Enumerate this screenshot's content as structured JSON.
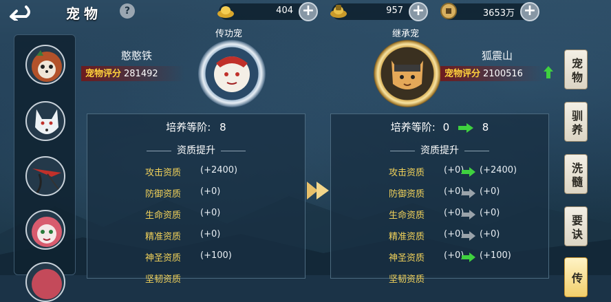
{
  "header": {
    "title": "宠物",
    "help_label": "?"
  },
  "resources": [
    {
      "icon": "gold-ingot-icon",
      "value": "404"
    },
    {
      "icon": "bound-ingot-icon",
      "value": "957"
    },
    {
      "icon": "copper-coin-icon",
      "value": "3653万"
    }
  ],
  "pets": [
    {
      "name": "red-panda-avatar"
    },
    {
      "name": "white-wolf-avatar"
    },
    {
      "name": "crane-avatar"
    },
    {
      "name": "lion-dance-cat-avatar"
    },
    {
      "name": "pet-avatar-5"
    }
  ],
  "left": {
    "role": "传功宠",
    "name": "憨憨铁",
    "score_label": "宠物评分",
    "score": "281492",
    "level_label": "培养等阶:",
    "level": "8",
    "section": "资质提升",
    "rows": [
      {
        "k": "攻击资质",
        "v": "(+2400)"
      },
      {
        "k": "防御资质",
        "v": "(+0)"
      },
      {
        "k": "生命资质",
        "v": "(+0)"
      },
      {
        "k": "精准资质",
        "v": "(+0)"
      },
      {
        "k": "神圣资质",
        "v": "(+100)"
      },
      {
        "k": "坚韧资质",
        "v": ""
      }
    ]
  },
  "right": {
    "role": "继承宠",
    "name": "狐震山",
    "score_label": "宠物评分",
    "score": "2100516",
    "level_label": "培养等阶:",
    "level_from": "0",
    "level_to": "8",
    "section": "资质提升",
    "rows": [
      {
        "k": "攻击资质",
        "v": "(+0)",
        "r": "(+2400)",
        "up": true
      },
      {
        "k": "防御资质",
        "v": "(+0)",
        "r": "(+0)",
        "up": false
      },
      {
        "k": "生命资质",
        "v": "(+0)",
        "r": "(+0)",
        "up": false
      },
      {
        "k": "精准资质",
        "v": "(+0)",
        "r": "(+0)",
        "up": false
      },
      {
        "k": "神圣资质",
        "v": "(+0)",
        "r": "(+100)",
        "up": true
      },
      {
        "k": "坚韧资质",
        "v": "",
        "r": "",
        "up": false
      }
    ]
  },
  "tabs": [
    "宠物",
    "驯养",
    "洗髓",
    "要诀",
    "传"
  ],
  "colors": {
    "accent_gold": "#ffd23c",
    "arrow_green": "#3fd13f",
    "arrow_gray": "#9aa3aa"
  }
}
